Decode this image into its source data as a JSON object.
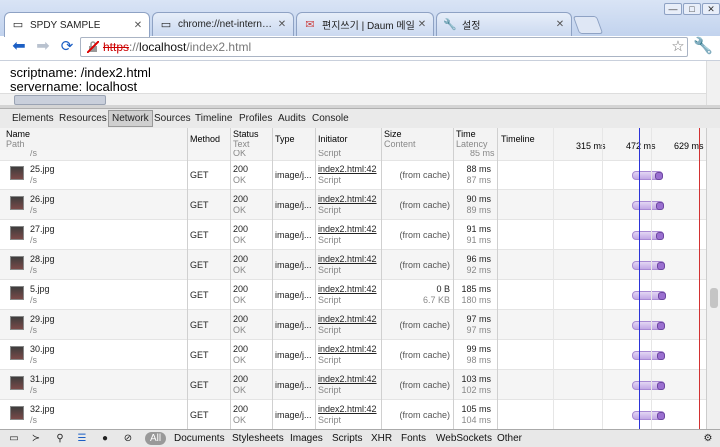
{
  "browser": {
    "tabs": [
      {
        "label": "SPDY SAMPLE",
        "icon": "page-icon"
      },
      {
        "label": "chrome://net-internals/#ev",
        "icon": "page-icon"
      },
      {
        "label": "편지쓰기 | Daum 메일",
        "icon": "mail-icon"
      },
      {
        "label": "설정",
        "icon": "wrench-icon"
      }
    ],
    "url": {
      "scheme": "https",
      "sep": "://",
      "host": "localhost",
      "path": "/index2.html"
    },
    "window_buttons": [
      "—",
      "□",
      "✕"
    ]
  },
  "page": {
    "lines": [
      "scriptname: /index2.html",
      "servername: localhost"
    ]
  },
  "devtools": {
    "tabs": [
      "Elements",
      "Resources",
      "Network",
      "Sources",
      "Timeline",
      "Profiles",
      "Audits",
      "Console"
    ],
    "selected_tab": "Network",
    "columns": {
      "name": "Name",
      "name_sub": "Path",
      "method": "Method",
      "status": "Status",
      "status_sub": "Text",
      "type": "Type",
      "initiator": "Initiator",
      "size": "Size",
      "size_sub": "Content",
      "time": "Time",
      "time_sub": "Latency",
      "timeline": "Timeline",
      "ticks": [
        "315 ms",
        "472 ms",
        "629 ms"
      ]
    },
    "partial_row": {
      "path": "/s",
      "status_text": "OK",
      "initiator_sub": "Script",
      "latency": "85 ms"
    },
    "rows": [
      {
        "name": "25.jpg",
        "path": "/s",
        "method": "GET",
        "status": "200",
        "status_text": "OK",
        "type": "image/j...",
        "initiator": "index2.html:42",
        "initiator_sub": "Script",
        "size": "(from cache)",
        "content": "",
        "time": "88 ms",
        "latency": "87 ms",
        "bar_start": 0.16,
        "bar_end": 0.93
      },
      {
        "name": "26.jpg",
        "path": "/s",
        "method": "GET",
        "status": "200",
        "status_text": "OK",
        "type": "image/j...",
        "initiator": "index2.html:42",
        "initiator_sub": "Script",
        "size": "(from cache)",
        "content": "",
        "time": "90 ms",
        "latency": "89 ms",
        "bar_start": 0.16,
        "bar_end": 0.95
      },
      {
        "name": "27.jpg",
        "path": "/s",
        "method": "GET",
        "status": "200",
        "status_text": "OK",
        "type": "image/j...",
        "initiator": "index2.html:42",
        "initiator_sub": "Script",
        "size": "(from cache)",
        "content": "",
        "time": "91 ms",
        "latency": "91 ms",
        "bar_start": 0.16,
        "bar_end": 0.96
      },
      {
        "name": "28.jpg",
        "path": "/s",
        "method": "GET",
        "status": "200",
        "status_text": "OK",
        "type": "image/j...",
        "initiator": "index2.html:42",
        "initiator_sub": "Script",
        "size": "(from cache)",
        "content": "",
        "time": "96 ms",
        "latency": "92 ms",
        "bar_start": 0.16,
        "bar_end": 0.97
      },
      {
        "name": "5.jpg",
        "path": "/s",
        "method": "GET",
        "status": "200",
        "status_text": "OK",
        "type": "image/j...",
        "initiator": "index2.html:42",
        "initiator_sub": "Script",
        "size": "0 B",
        "content": "6.7 KB",
        "time": "185 ms",
        "latency": "180 ms",
        "bar_start": 0.16,
        "bar_end": 1.0
      },
      {
        "name": "29.jpg",
        "path": "/s",
        "method": "GET",
        "status": "200",
        "status_text": "OK",
        "type": "image/j...",
        "initiator": "index2.html:42",
        "initiator_sub": "Script",
        "size": "(from cache)",
        "content": "",
        "time": "97 ms",
        "latency": "97 ms",
        "bar_start": 0.16,
        "bar_end": 0.98
      },
      {
        "name": "30.jpg",
        "path": "/s",
        "method": "GET",
        "status": "200",
        "status_text": "OK",
        "type": "image/j...",
        "initiator": "index2.html:42",
        "initiator_sub": "Script",
        "size": "(from cache)",
        "content": "",
        "time": "99 ms",
        "latency": "98 ms",
        "bar_start": 0.16,
        "bar_end": 0.98
      },
      {
        "name": "31.jpg",
        "path": "/s",
        "method": "GET",
        "status": "200",
        "status_text": "OK",
        "type": "image/j...",
        "initiator": "index2.html:42",
        "initiator_sub": "Script",
        "size": "(from cache)",
        "content": "",
        "time": "103 ms",
        "latency": "102 ms",
        "bar_start": 0.16,
        "bar_end": 0.98
      },
      {
        "name": "32.jpg",
        "path": "/s",
        "method": "GET",
        "status": "200",
        "status_text": "OK",
        "type": "image/j...",
        "initiator": "index2.html:42",
        "initiator_sub": "Script",
        "size": "(from cache)",
        "content": "",
        "time": "105 ms",
        "latency": "104 ms",
        "bar_start": 0.16,
        "bar_end": 0.98
      }
    ],
    "filters": [
      "All",
      "Documents",
      "Stylesheets",
      "Images",
      "Scripts",
      "XHR",
      "Fonts",
      "WebSockets",
      "Other"
    ],
    "selected_filter": "All"
  },
  "colors": {
    "accent_blue": "#2c34d8",
    "load_red": "#d23232",
    "bar_purple": "#c2a8e5"
  }
}
